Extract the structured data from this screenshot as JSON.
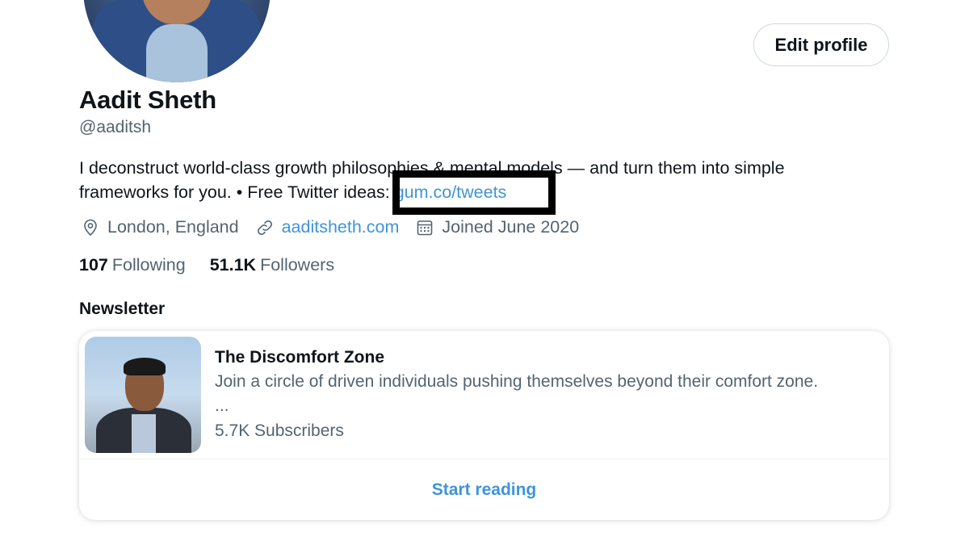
{
  "profile": {
    "name": "Aadit Sheth",
    "handle": "@aaditsh",
    "edit_label": "Edit profile",
    "bio_text": "I deconstruct world-class growth philosophies & mental models — and turn them into simple frameworks for you. • Free Twitter ideas: ",
    "bio_link": "gum.co/tweets",
    "location": "London, England",
    "website": "aaditsheth.com",
    "joined": "Joined June 2020"
  },
  "stats": {
    "following_count": "107",
    "following_label": "Following",
    "followers_count": "51.1K",
    "followers_label": "Followers"
  },
  "newsletter": {
    "section_label": "Newsletter",
    "title": "The Discomfort Zone",
    "description": "Join a circle of driven individuals pushing themselves beyond their comfort zone.",
    "ellipsis": "...",
    "subscribers": "5.7K Subscribers",
    "cta": "Start reading"
  },
  "colors": {
    "link": "#3f94d9",
    "secondary_text": "#536471",
    "primary_text": "#0f1419",
    "redaction_box": "#000000"
  },
  "icons": [
    "location-pin-icon",
    "link-icon",
    "calendar-icon"
  ]
}
